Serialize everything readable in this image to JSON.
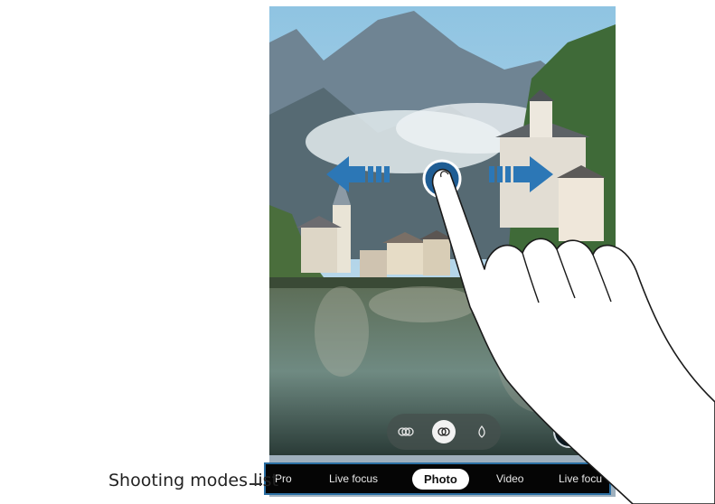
{
  "callout": {
    "label": "Shooting modes list"
  },
  "mode_bar": {
    "items": [
      "Pro",
      "Live focus",
      "Photo",
      "Video",
      "Live focu"
    ],
    "selected": "Photo"
  },
  "lens_buttons": [
    "ultra-wide-lens-icon",
    "wide-lens-icon",
    "telephoto-lens-icon"
  ],
  "gesture": {
    "swipe_left_icon": "arrow-left-icon",
    "swipe_right_icon": "arrow-right-icon",
    "touch_point_icon": "touch-circle-icon",
    "hand_icon": "pointing-hand-icon"
  },
  "colors": {
    "arrow": "#2c77b6",
    "callout_border": "#2b6fa3",
    "mode_bar_bg": "#050505"
  }
}
